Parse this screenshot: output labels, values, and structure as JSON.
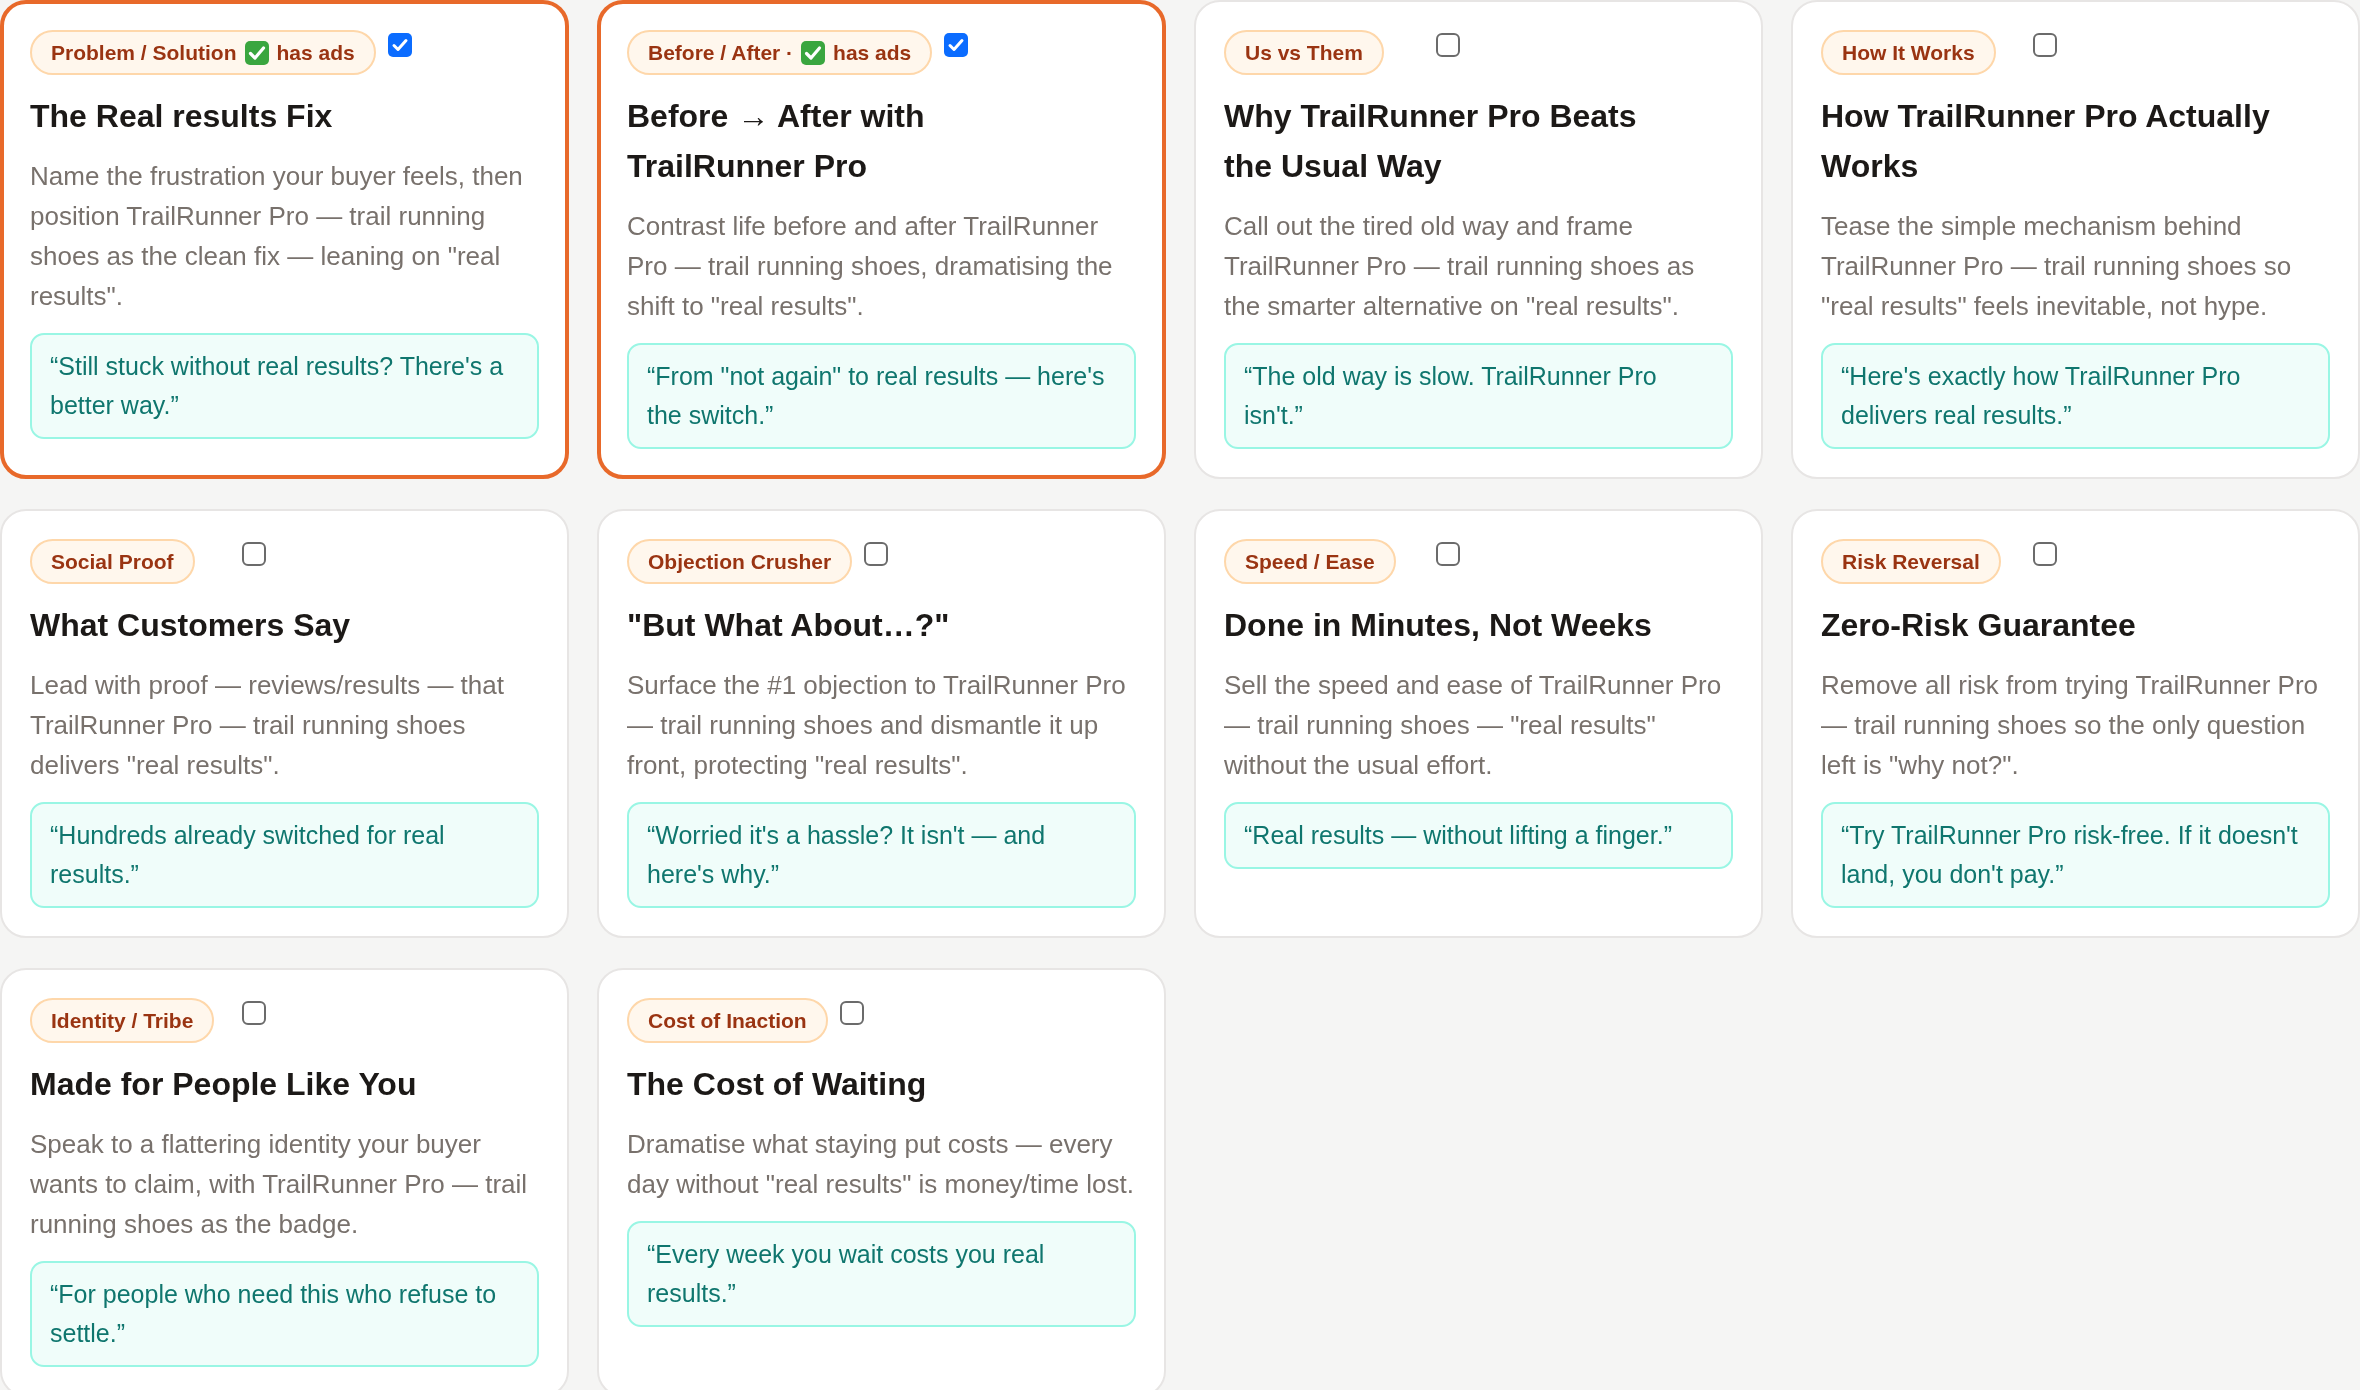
{
  "cards": [
    {
      "badge": {
        "label": "Problem / Solution",
        "ads_note": "has ads"
      },
      "selected": true,
      "title": "The Real results Fix",
      "description": "Name the frustration your buyer feels, then position TrailRunner Pro — trail running shoes as the clean fix — leaning on \"real results\".",
      "quote": "“Still stuck without real results? There's a better way.”"
    },
    {
      "badge": {
        "label": "Before / After ·",
        "ads_note": "has ads"
      },
      "selected": true,
      "title": "Before → After with TrailRunner Pro",
      "description": "Contrast life before and after TrailRunner Pro — trail running shoes, dramatising the shift to \"real results\".",
      "quote": "“From \"not again\" to real results — here's the switch.”"
    },
    {
      "badge": {
        "label": "Us vs Them"
      },
      "selected": false,
      "title": "Why TrailRunner Pro Beats the Usual Way",
      "description": "Call out the tired old way and frame TrailRunner Pro — trail running shoes as the smarter alternative on \"real results\".",
      "quote": "“The old way is slow. TrailRunner Pro isn't.”"
    },
    {
      "badge": {
        "label": "How It Works"
      },
      "selected": false,
      "title": "How TrailRunner Pro Actually Works",
      "description": "Tease the simple mechanism behind TrailRunner Pro — trail running shoes so \"real results\" feels inevitable, not hype.",
      "quote": "“Here's exactly how TrailRunner Pro delivers real results.”"
    },
    {
      "badge": {
        "label": "Social Proof"
      },
      "selected": false,
      "title": "What Customers Say",
      "description": "Lead with proof — reviews/results — that TrailRunner Pro — trail running shoes delivers \"real results\".",
      "quote": "“Hundreds already switched for real results.”"
    },
    {
      "badge": {
        "label": "Objection Crusher"
      },
      "selected": false,
      "title": "\"But What About…?\"",
      "description": "Surface the #1 objection to TrailRunner Pro — trail running shoes and dismantle it up front, protecting \"real results\".",
      "quote": "“Worried it's a hassle? It isn't — and here's why.”"
    },
    {
      "badge": {
        "label": "Speed / Ease"
      },
      "selected": false,
      "title": "Done in Minutes, Not Weeks",
      "description": "Sell the speed and ease of TrailRunner Pro — trail running shoes — \"real results\" without the usual effort.",
      "quote": "“Real results — without lifting a finger.”"
    },
    {
      "badge": {
        "label": "Risk Reversal"
      },
      "selected": false,
      "title": "Zero-Risk Guarantee",
      "description": "Remove all risk from trying TrailRunner Pro — trail running shoes so the only question left is \"why not?\".",
      "quote": "“Try TrailRunner Pro risk-free. If it doesn't land, you don't pay.”"
    },
    {
      "badge": {
        "label": "Identity / Tribe"
      },
      "selected": false,
      "title": "Made for People Like You",
      "description": "Speak to a flattering identity your buyer wants to claim, with TrailRunner Pro — trail running shoes as the badge.",
      "quote": "“For people who need this who refuse to settle.”"
    },
    {
      "badge": {
        "label": "Cost of Inaction"
      },
      "selected": false,
      "title": "The Cost of Waiting",
      "description": "Dramatise what staying put costs — every day without \"real results\" is money/time lost.",
      "quote": "“Every week you wait costs you real results.”"
    }
  ]
}
